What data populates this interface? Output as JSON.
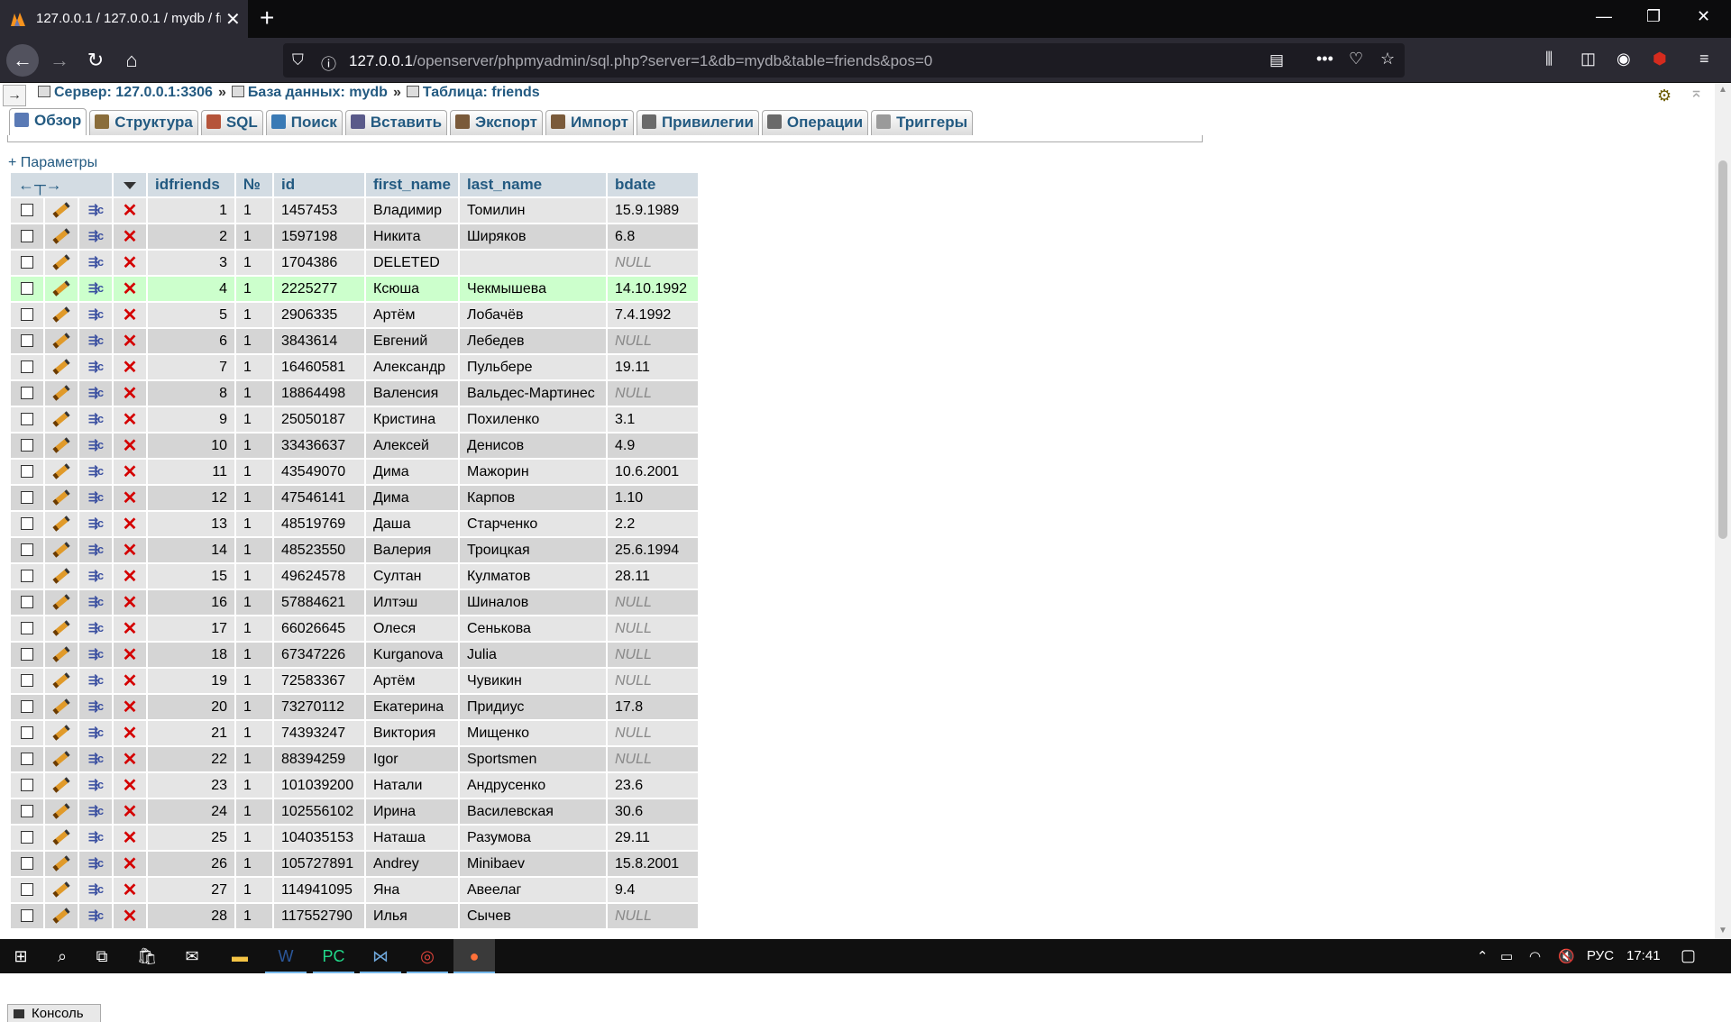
{
  "browser": {
    "tab_title": "127.0.0.1 / 127.0.0.1 / mydb / friends",
    "url_host": "127.0.0.1",
    "url_rest": "/openserver/phpmyadmin/sql.php?server=1&db=mydb&table=friends&pos=0"
  },
  "breadcrumb": {
    "server": "Сервер: 127.0.0.1:3306",
    "database": "База данных: mydb",
    "table": "Таблица: friends",
    "separator": "»"
  },
  "tabs": [
    {
      "label": "Обзор",
      "icon": "browse-icon",
      "color": "#5a7ab5"
    },
    {
      "label": "Структура",
      "icon": "structure-icon",
      "color": "#8a6d3b"
    },
    {
      "label": "SQL",
      "icon": "sql-icon",
      "color": "#b5543a"
    },
    {
      "label": "Поиск",
      "icon": "search-icon",
      "color": "#3a7ab5"
    },
    {
      "label": "Вставить",
      "icon": "insert-icon",
      "color": "#5a5a8a"
    },
    {
      "label": "Экспорт",
      "icon": "export-icon",
      "color": "#7a5a3a"
    },
    {
      "label": "Импорт",
      "icon": "import-icon",
      "color": "#7a5a3a"
    },
    {
      "label": "Привилегии",
      "icon": "privileges-icon",
      "color": "#6a6a6a"
    },
    {
      "label": "Операции",
      "icon": "operations-icon",
      "color": "#6a6a6a"
    },
    {
      "label": "Триггеры",
      "icon": "triggers-icon",
      "color": "#9a9a9a"
    }
  ],
  "params_label": "+ Параметры",
  "columns": [
    "idfriends",
    "№",
    "id",
    "first_name",
    "last_name",
    "bdate"
  ],
  "rows": [
    [
      "1",
      "1",
      "1457453",
      "Владимир",
      "Томилин",
      "15.9.1989"
    ],
    [
      "2",
      "1",
      "1597198",
      "Никита",
      "Ширяков",
      "6.8"
    ],
    [
      "3",
      "1",
      "1704386",
      "DELETED",
      "",
      "NULL"
    ],
    [
      "4",
      "1",
      "2225277",
      "Ксюша",
      "Чекмышева",
      "14.10.1992"
    ],
    [
      "5",
      "1",
      "2906335",
      "Артём",
      "Лобачёв",
      "7.4.1992"
    ],
    [
      "6",
      "1",
      "3843614",
      "Евгений",
      "Лебедев",
      "NULL"
    ],
    [
      "7",
      "1",
      "16460581",
      "Александр",
      "Пульбере",
      "19.11"
    ],
    [
      "8",
      "1",
      "18864498",
      "Валенсия",
      "Вальдес-Мартинес",
      "NULL"
    ],
    [
      "9",
      "1",
      "25050187",
      "Кристина",
      "Похиленко",
      "3.1"
    ],
    [
      "10",
      "1",
      "33436637",
      "Алексей",
      "Денисов",
      "4.9"
    ],
    [
      "11",
      "1",
      "43549070",
      "Дима",
      "Мажорин",
      "10.6.2001"
    ],
    [
      "12",
      "1",
      "47546141",
      "Дима",
      "Карпов",
      "1.10"
    ],
    [
      "13",
      "1",
      "48519769",
      "Даша",
      "Старченко",
      "2.2"
    ],
    [
      "14",
      "1",
      "48523550",
      "Валерия",
      "Троицкая",
      "25.6.1994"
    ],
    [
      "15",
      "1",
      "49624578",
      "Султан",
      "Кулматов",
      "28.11"
    ],
    [
      "16",
      "1",
      "57884621",
      "Илтэш",
      "Шиналов",
      "NULL"
    ],
    [
      "17",
      "1",
      "66026645",
      "Олеся",
      "Сенькова",
      "NULL"
    ],
    [
      "18",
      "1",
      "67347226",
      "Kurganova",
      "Julia",
      "NULL"
    ],
    [
      "19",
      "1",
      "72583367",
      "Артём",
      "Чувикин",
      "NULL"
    ],
    [
      "20",
      "1",
      "73270112",
      "Екатерина",
      "Придиус",
      "17.8"
    ],
    [
      "21",
      "1",
      "74393247",
      "Виктория",
      "Мищенко",
      "NULL"
    ],
    [
      "22",
      "1",
      "88394259",
      "Igor",
      "Sportsmen",
      "NULL"
    ],
    [
      "23",
      "1",
      "101039200",
      "Натали",
      "Андрусенко",
      "23.6"
    ],
    [
      "24",
      "1",
      "102556102",
      "Ирина",
      "Василевская",
      "30.6"
    ],
    [
      "25",
      "1",
      "104035153",
      "Наташа",
      "Разумова",
      "29.11"
    ],
    [
      "26",
      "1",
      "105727891",
      "Andrey",
      "Minibaev",
      "15.8.2001"
    ],
    [
      "27",
      "1",
      "114941095",
      "Яна",
      "Авеелаг",
      "9.4"
    ],
    [
      "28",
      "1",
      "117552790",
      "Илья",
      "Сычев",
      "NULL"
    ]
  ],
  "highlighted_row": 4,
  "console_label": "Консоль",
  "taskbar": {
    "lang": "РУС",
    "time": "17:41"
  }
}
